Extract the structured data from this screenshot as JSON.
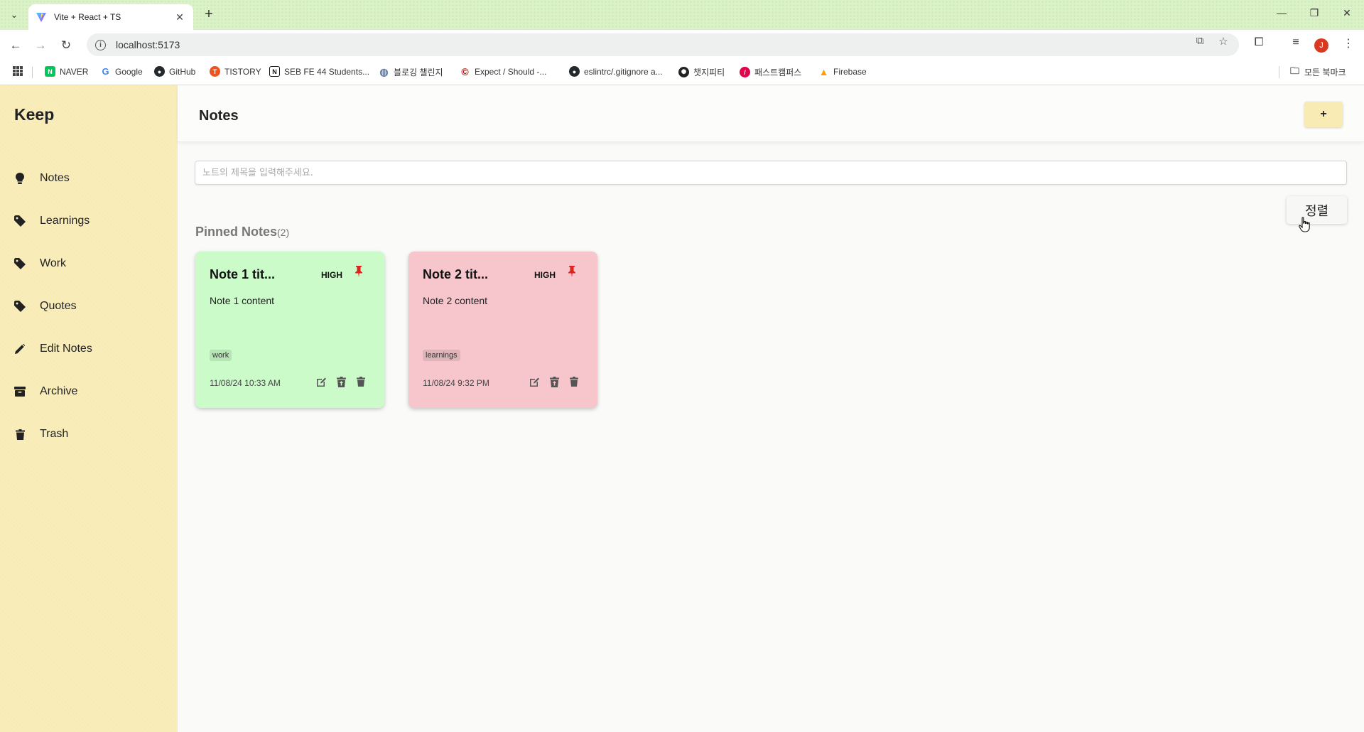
{
  "browser": {
    "tab_title": "Vite + React + TS",
    "url": "localhost:5173",
    "bookmarks": [
      {
        "label": "NAVER",
        "icon": "naver-icon",
        "color": "#03c75a"
      },
      {
        "label": "Google",
        "icon": "google-icon",
        "color": "#4285f4"
      },
      {
        "label": "GitHub",
        "icon": "github-icon",
        "color": "#24292e"
      },
      {
        "label": "TISTORY",
        "icon": "tistory-icon",
        "color": "#eb531f"
      },
      {
        "label": "SEB FE 44 Students...",
        "icon": "notion-icon",
        "color": "#111111"
      },
      {
        "label": "블로깅 챌린지",
        "icon": "globe-icon",
        "color": "#5b7fb5"
      },
      {
        "label": "Expect / Should -...",
        "icon": "chai-icon",
        "color": "#a30701"
      },
      {
        "label": "eslintrc/.gitignore a...",
        "icon": "github-icon",
        "color": "#24292e"
      },
      {
        "label": "챗지피티",
        "icon": "chatgpt-icon",
        "color": "#222222"
      },
      {
        "label": "패스트캠퍼스",
        "icon": "fastcampus-icon",
        "color": "#e5024b"
      },
      {
        "label": "Firebase",
        "icon": "firebase-icon",
        "color": "#ffa000"
      }
    ],
    "all_bookmarks_label": "모든 북마크",
    "profile_initial": "J"
  },
  "sidebar": {
    "brand": "Keep",
    "items": [
      {
        "label": "Notes",
        "icon": "lightbulb-icon"
      },
      {
        "label": "Learnings",
        "icon": "tag-icon"
      },
      {
        "label": "Work",
        "icon": "tag-icon"
      },
      {
        "label": "Quotes",
        "icon": "tag-icon"
      },
      {
        "label": "Edit Notes",
        "icon": "pencil-icon"
      },
      {
        "label": "Archive",
        "icon": "archive-icon"
      },
      {
        "label": "Trash",
        "icon": "trash-icon"
      }
    ]
  },
  "header": {
    "title": "Notes",
    "add_label": "+"
  },
  "search": {
    "placeholder": "노트의 제목을 입력해주세요."
  },
  "sort_label": "정렬",
  "pinned": {
    "title": "Pinned Notes",
    "count": "(2)"
  },
  "notes": [
    {
      "title": "Note 1 tit...",
      "priority": "HIGH",
      "content": "Note 1 content",
      "tag": "work",
      "date": "11/08/24 10:33 AM",
      "color": "#cafbc9"
    },
    {
      "title": "Note 2 tit...",
      "priority": "HIGH",
      "content": "Note 2 content",
      "tag": "learnings",
      "date": "11/08/24 9:32 PM",
      "color": "#f6c6cc"
    }
  ],
  "colors": {
    "sidebar": "#f8ebb4",
    "accent_pin": "#e0221e"
  }
}
